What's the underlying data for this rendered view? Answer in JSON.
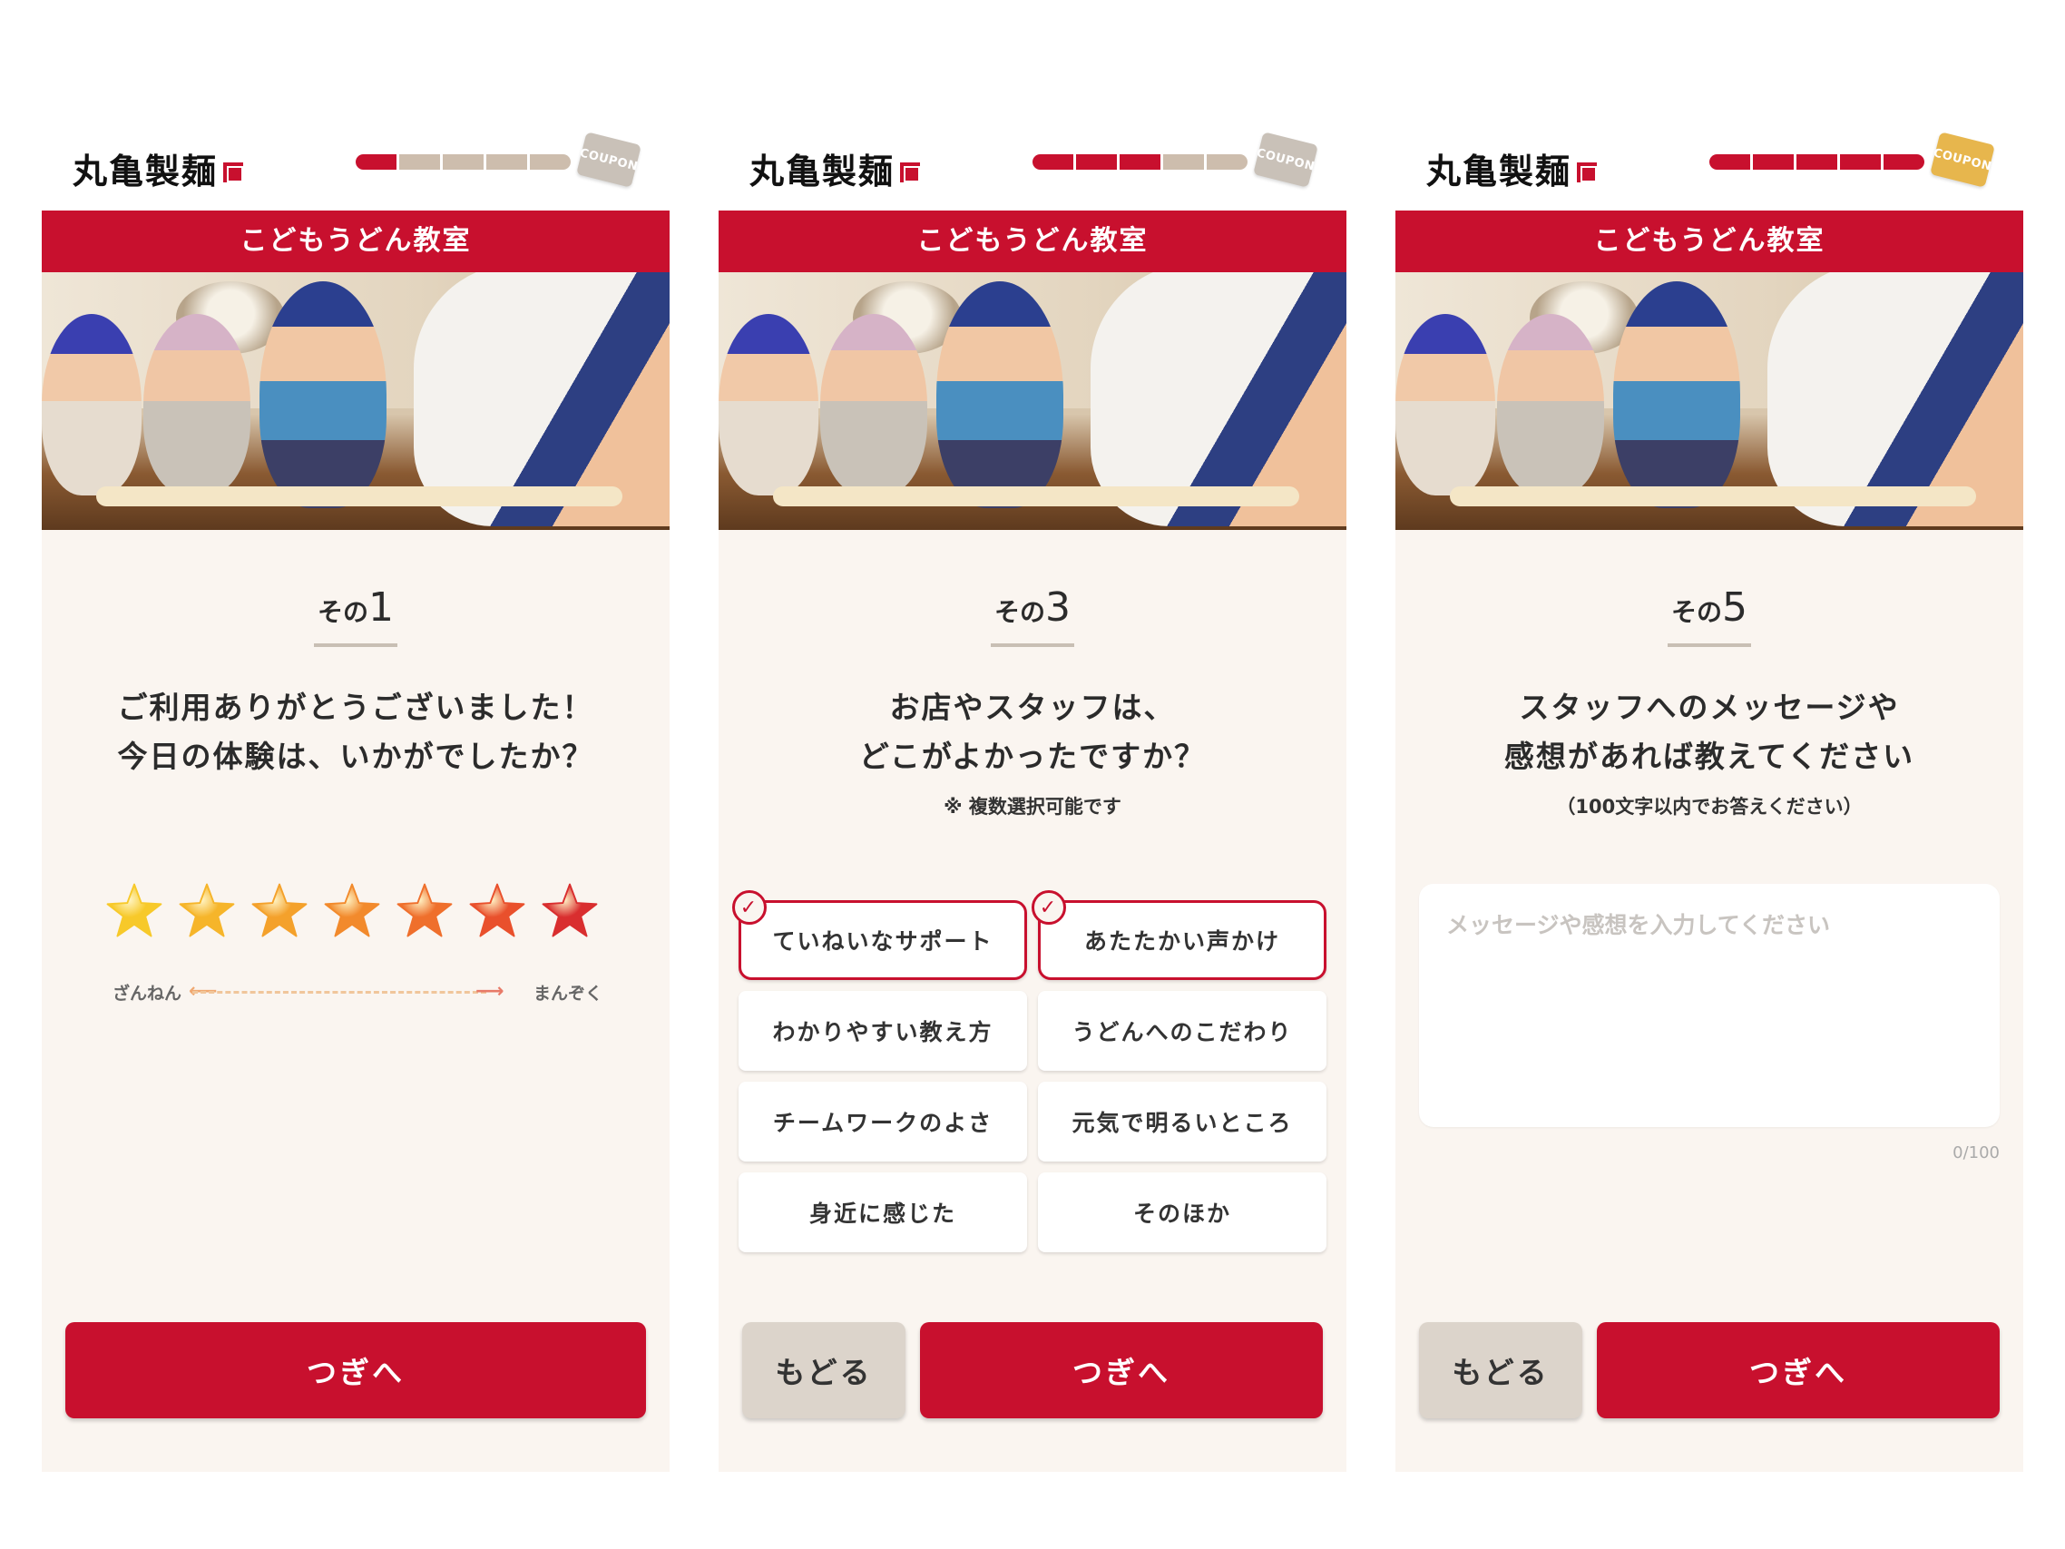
{
  "brand": {
    "logo_text": "丸亀製麺",
    "coupon_label": "COUPON"
  },
  "colors": {
    "accent": "#c8102e",
    "background": "#faf5f0",
    "progress_off": "#cdbdad"
  },
  "screens": [
    {
      "banner": "こどもうどん教室",
      "progress": {
        "total": 5,
        "completed": 1
      },
      "step": {
        "prefix": "その",
        "number": "1"
      },
      "question": {
        "line1": "ご利用ありがとうございました！",
        "line2": "今日の体験は、いかがでしたか？"
      },
      "rating": {
        "max": 7,
        "left_label": "ざんねん",
        "right_label": "まんぞく",
        "star_colors": [
          "#f7c92a",
          "#f6b52a",
          "#f4a12b",
          "#f28a2c",
          "#ef6f2c",
          "#e9502c",
          "#d92e2f"
        ]
      },
      "buttons": {
        "next": "つぎへ"
      }
    },
    {
      "banner": "こどもうどん教室",
      "progress": {
        "total": 5,
        "completed": 3
      },
      "step": {
        "prefix": "その",
        "number": "3"
      },
      "question": {
        "line1": "お店やスタッフは、",
        "line2": "どこがよかったですか？"
      },
      "note": "※ 複数選択可能です",
      "options": [
        {
          "label": "ていねいなサポート",
          "selected": true
        },
        {
          "label": "あたたかい声かけ",
          "selected": true
        },
        {
          "label": "わかりやすい教え方",
          "selected": false
        },
        {
          "label": "うどんへのこだわり",
          "selected": false
        },
        {
          "label": "チームワークのよさ",
          "selected": false
        },
        {
          "label": "元気で明るいところ",
          "selected": false
        },
        {
          "label": "身近に感じた",
          "selected": false
        },
        {
          "label": "そのほか",
          "selected": false
        }
      ],
      "buttons": {
        "back": "もどる",
        "next": "つぎへ"
      }
    },
    {
      "banner": "こどもうどん教室",
      "progress": {
        "total": 5,
        "completed": 5
      },
      "step": {
        "prefix": "その",
        "number": "5"
      },
      "question": {
        "line1": "スタッフへのメッセージや",
        "line2": "感想があれば教えてください"
      },
      "note": "（100文字以内でお答えください）",
      "message": {
        "placeholder": "メッセージや感想を入力してください",
        "value": "",
        "counter": "0/100"
      },
      "buttons": {
        "back": "もどる",
        "next": "つぎへ"
      }
    }
  ]
}
